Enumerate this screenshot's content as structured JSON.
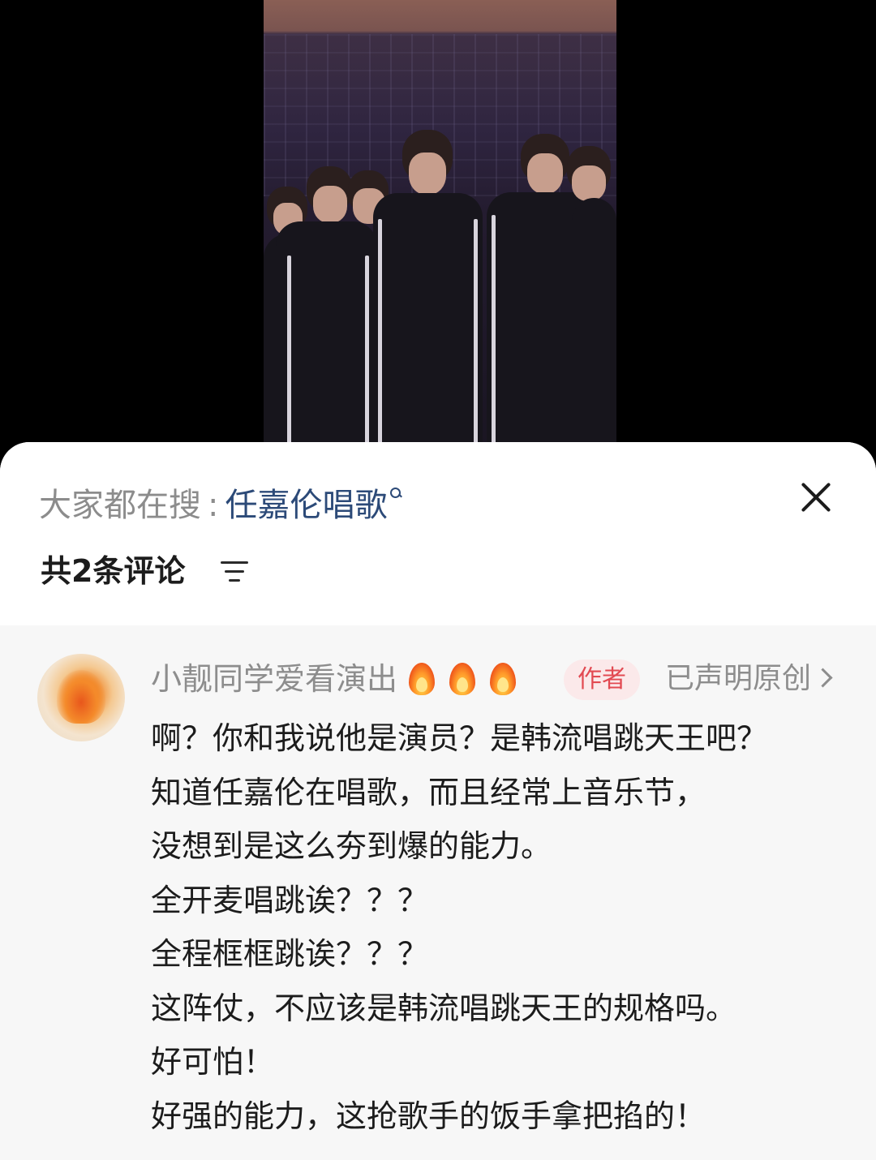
{
  "search": {
    "prefix": "大家都在搜",
    "separator": ":",
    "term": "任嘉伦唱歌"
  },
  "comments_header": {
    "count_label": "共2条评论"
  },
  "comment": {
    "username": "小靓同学爱看演出",
    "badge": "作者",
    "original_label": "已声明原创",
    "lines": [
      "啊？你和我说他是演员？是韩流唱跳天王吧？",
      "知道任嘉伦在唱歌，而且经常上音乐节，",
      "没想到是这么夯到爆的能力。",
      "全开麦唱跳诶？？？",
      "全程框框跳诶？？？",
      "这阵仗，不应该是韩流唱跳天王的规格吗。",
      "好可怕！",
      "好强的能力，这抢歌手的饭手拿把掐的！"
    ]
  },
  "icons": {
    "close": "close-icon",
    "sort": "sort-icon",
    "search": "search-icon",
    "fire": "fire-emoji",
    "chevron": "chevron-right-icon"
  },
  "colors": {
    "search_term": "#2c4a78",
    "author_badge_text": "#e24a52",
    "author_badge_bg": "#fbe9ea",
    "muted_text": "#8d8d8d",
    "sheet_bg": "#f7f7f7"
  }
}
